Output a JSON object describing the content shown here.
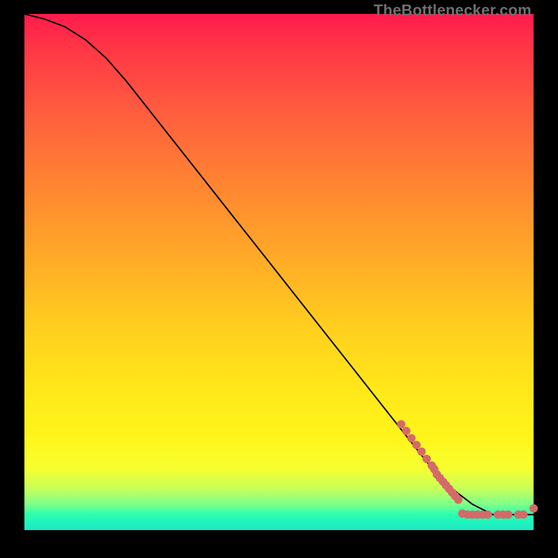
{
  "watermark": "TheBottlenecker.com",
  "accent_dot_color": "#d46a6a",
  "line_color": "#000000",
  "chart_data": {
    "type": "line",
    "title": "",
    "xlabel": "",
    "ylabel": "",
    "xlim": [
      0,
      100
    ],
    "ylim": [
      0,
      100
    ],
    "series": [
      {
        "name": "curve",
        "x": [
          0,
          4,
          8,
          12,
          16,
          20,
          28,
          36,
          44,
          52,
          60,
          68,
          72,
          76,
          80,
          84,
          88,
          92,
          96,
          100
        ],
        "y": [
          100,
          99,
          97.5,
          95,
          91.5,
          87,
          77,
          67,
          57,
          47,
          37,
          27,
          22,
          17,
          12,
          8,
          5,
          3,
          3,
          3
        ]
      }
    ],
    "scatter": [
      {
        "name": "dots_upper_cluster",
        "x": [
          74,
          75,
          76,
          77,
          78,
          79,
          80,
          80.5
        ],
        "y": [
          20.5,
          19.2,
          17.8,
          16.5,
          15.2,
          13.8,
          12.5,
          11.8
        ]
      },
      {
        "name": "dots_mid_cluster",
        "x": [
          81,
          81.6,
          82.2,
          82.8,
          83.4,
          84,
          84.6,
          85.2
        ],
        "y": [
          10.8,
          10.1,
          9.4,
          8.7,
          8.0,
          7.3,
          6.6,
          5.9
        ]
      },
      {
        "name": "dots_flat_cluster",
        "x": [
          86,
          87,
          88,
          89,
          90,
          91,
          93,
          94,
          95,
          97,
          98
        ],
        "y": [
          3.2,
          3.0,
          3.0,
          3.0,
          3.0,
          3.0,
          3.0,
          3.0,
          3.0,
          3.0,
          3.0
        ]
      },
      {
        "name": "dot_far_right",
        "x": [
          100
        ],
        "y": [
          4.2
        ]
      }
    ]
  }
}
